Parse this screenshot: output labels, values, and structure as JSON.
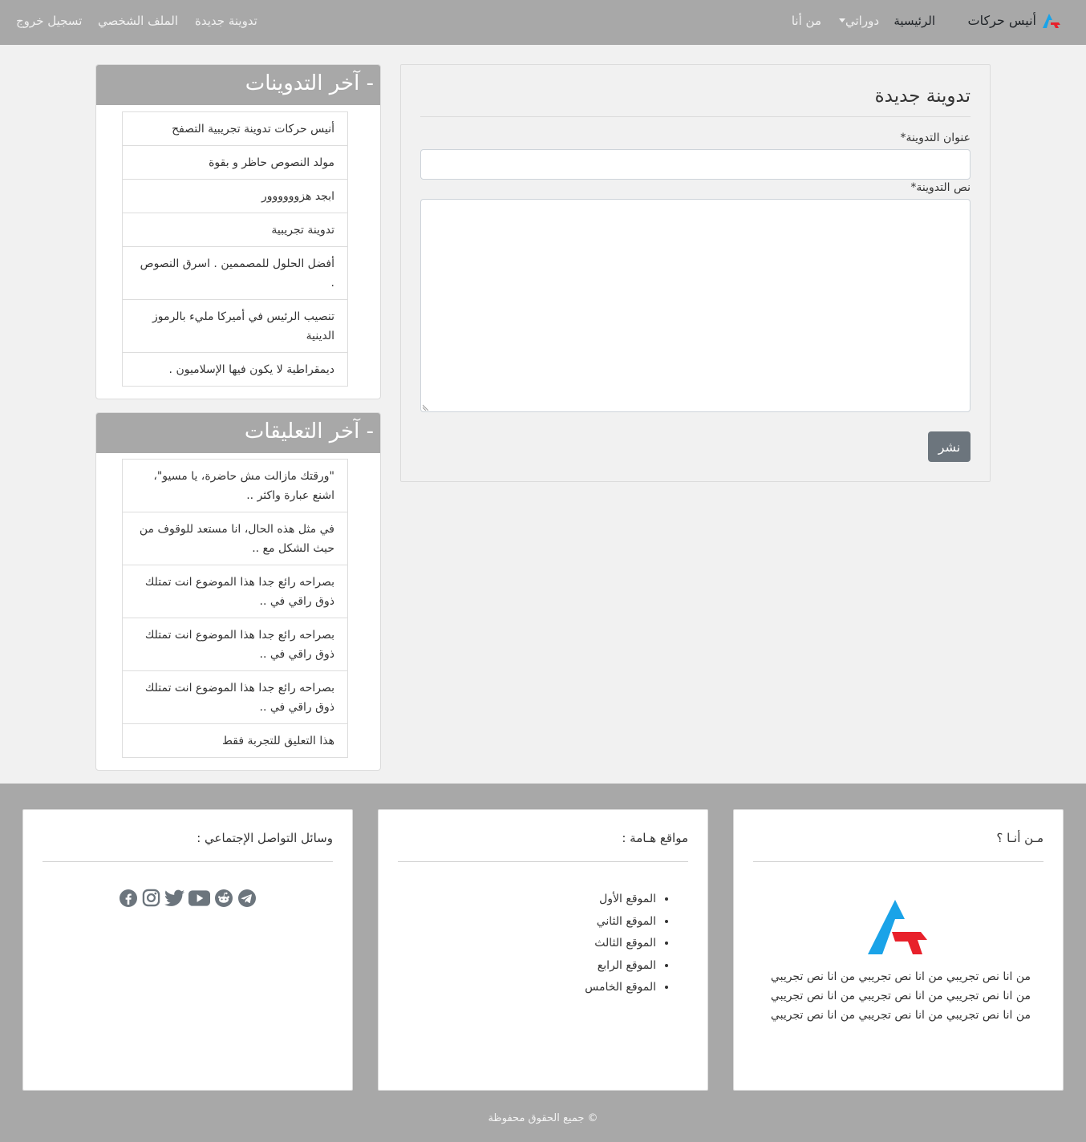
{
  "nav": {
    "brand": "أنيس حركات",
    "home": "الرئيسية",
    "courses": "دوراتي",
    "about": "من أنا",
    "new_post": "تدوينة جديدة",
    "profile": "الملف الشخصي",
    "logout": "تسجيل خروج"
  },
  "form": {
    "heading": "تدوينة جديدة",
    "title_label": "عنوان التدوينة*",
    "title_value": "",
    "body_label": "نص التدوينة*",
    "body_value": "",
    "submit": "نشر"
  },
  "latest_posts": {
    "heading": "- آخر التدوينات",
    "items": [
      "أنيس حركات تدوينة تجريبية التصفح",
      "مولد النصوص حاظر و بقوة",
      "ابجد هزوووووور",
      "تدوينة تجريبية",
      "أفضل الحلول للمصممين . اسرق النصوص .",
      "تنصيب الرئيس في أميركا مليء بالرموز الدينية",
      "ديمقراطية لا يكون فيها الإسلاميون ."
    ]
  },
  "latest_comments": {
    "heading": "- آخر التعليقات",
    "items": [
      "\"ورقتك مازالت مش حاضرة، يا مسيو\"، اشنع عبارة واكثر ..",
      "في مثل هذه الحال، انا مستعد للوقوف من حيث الشكل مع ..",
      "بصراحه رائع جدا هذا الموضوع انت تمتلك ذوق راقي في ..",
      "بصراحه رائع جدا هذا الموضوع انت تمتلك ذوق راقي في ..",
      "بصراحه رائع جدا هذا الموضوع انت تمتلك ذوق راقي في ..",
      "هذا التعليق للتجربة فقط"
    ]
  },
  "footer": {
    "about_title": "مـن أنـا ؟",
    "about_text": "من انا نص تجريبي من انا نص تجريبي من انا نص تجريبي من انا نص تجريبي من انا نص تجريبي من انا نص تجريبي من انا نص تجريبي من انا نص تجريبي من انا نص تجريبي",
    "sites_title": "مواقع هـامة :",
    "sites": [
      "الموقع الأول",
      "الموقع الثاني",
      "الموقع الثالث",
      "الموقع الرابع",
      "الموقع الخامس"
    ],
    "social_title": "وسائل التواصل الإجتماعي :",
    "social_icons": [
      "facebook-icon",
      "instagram-icon",
      "twitter-icon",
      "youtube-icon",
      "reddit-icon",
      "telegram-icon"
    ],
    "copyright": "© جميع الحقوق محفوظة"
  },
  "colors": {
    "navbar": "#a8a8a8",
    "logo_blue": "#1aa3e8",
    "logo_red": "#e8212b",
    "button": "#6c757d",
    "icon": "#6c757d"
  }
}
